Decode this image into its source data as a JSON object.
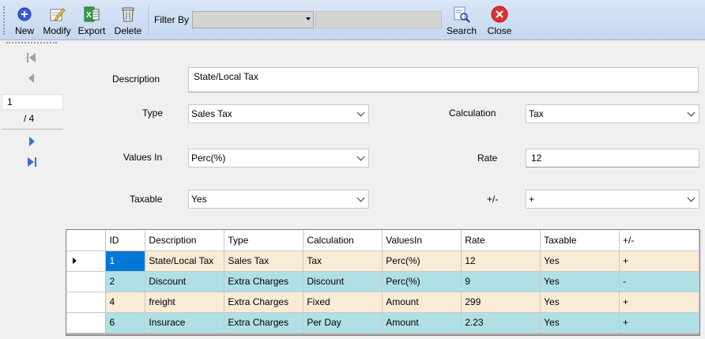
{
  "toolbar": {
    "new_label": "New",
    "modify_label": "Modify",
    "export_label": "Export",
    "delete_label": "Delete",
    "filter_label": "Filter By",
    "filter_value": "",
    "filter_text": "",
    "search_label": "Search",
    "close_label": "Close",
    "colors": {
      "new": "#3b5bdb",
      "close": "#e03131",
      "export": "#2f9e44"
    }
  },
  "navigator": {
    "position": "1",
    "count": "/ 4"
  },
  "form": {
    "description_label": "Description",
    "description_value": "State/Local Tax",
    "type_label": "Type",
    "type_value": "Sales Tax",
    "calculation_label": "Calculation",
    "calculation_value": "Tax",
    "values_in_label": "Values In",
    "values_in_value": "Perc(%)",
    "rate_label": "Rate",
    "rate_value": "12",
    "taxable_label": "Taxable",
    "taxable_value": "Yes",
    "plusminus_label": "+/-",
    "plusminus_value": "+"
  },
  "grid": {
    "columns": [
      "ID",
      "Description",
      "Type",
      "Calculation",
      "ValuesIn",
      "Rate",
      "Taxable",
      "+/-"
    ],
    "rows": [
      [
        "1",
        "State/Local Tax",
        "Sales Tax",
        "Tax",
        "Perc(%)",
        "12",
        "Yes",
        "+"
      ],
      [
        "2",
        "Discount",
        "Extra Charges",
        "Discount",
        "Perc(%)",
        "9",
        "Yes",
        "-"
      ],
      [
        "4",
        "freight",
        "Extra Charges",
        "Fixed",
        "Amount",
        "299",
        "Yes",
        "+"
      ],
      [
        "6",
        "Insurace",
        "Extra Charges",
        "Per Day",
        "Amount",
        "2.23",
        "Yes",
        "+"
      ]
    ],
    "row_colors": [
      "#faebd7",
      "#b0e0e6"
    ]
  }
}
